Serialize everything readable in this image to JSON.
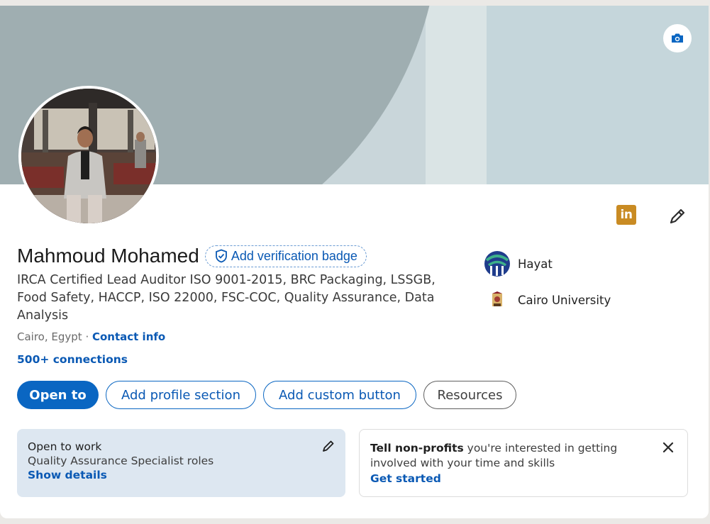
{
  "profile": {
    "name": "Mahmoud Mohamed",
    "verification_label": "Add verification badge",
    "headline": "IRCA Certified Lead Auditor ISO 9001-2015, BRC Packaging, LSSGB, Food Safety, HACCP, ISO 22000, FSC-COC, Quality Assurance, Data Analysis",
    "location": "Cairo, Egypt",
    "location_separator": " · ",
    "contact_info_label": "Contact info",
    "connections": "500+ connections"
  },
  "actions": {
    "open_to": "Open to",
    "add_profile_section": "Add profile section",
    "add_custom_button": "Add custom button",
    "resources": "Resources"
  },
  "organizations": [
    {
      "name": "Hayat",
      "logo": "hayat-logo"
    },
    {
      "name": "Cairo University",
      "logo": "cairo-university-logo"
    }
  ],
  "open_to_work": {
    "title": "Open to work",
    "roles": "Quality Assurance Specialist roles",
    "link": "Show details"
  },
  "nonprofits": {
    "lead": "Tell non-profits",
    "rest": " you're interested in getting involved with your time and skills",
    "link": "Get started"
  },
  "badge": {
    "linkedin_text": "in"
  },
  "colors": {
    "primary": "#0a66c2",
    "link": "#0a59b4",
    "linkedin_badge": "#c98b23",
    "open_to_work_bg": "#dde7f1",
    "cover_arc": "#9faeb1"
  },
  "icons": [
    "camera-icon",
    "pencil-icon",
    "shield-check-icon",
    "close-icon"
  ]
}
